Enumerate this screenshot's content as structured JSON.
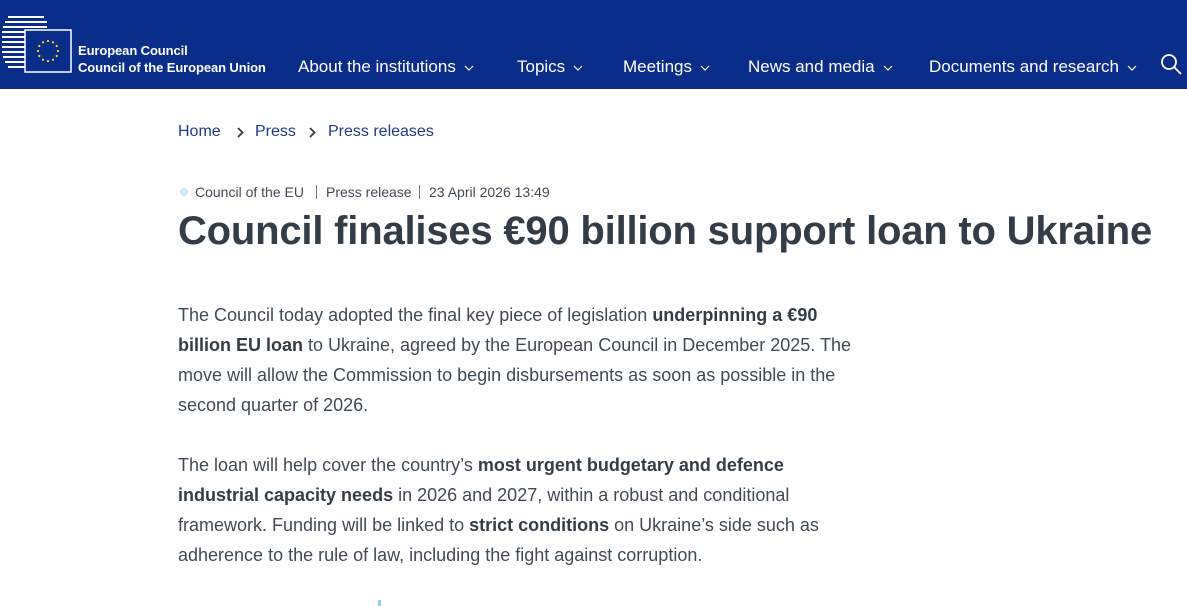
{
  "header": {
    "brand_line1": "European Council",
    "brand_line2": "Council of the European Union",
    "nav": [
      {
        "label": "About the institutions"
      },
      {
        "label": "Topics"
      },
      {
        "label": "Meetings"
      },
      {
        "label": "News and media"
      },
      {
        "label": "Documents and research"
      }
    ],
    "icons": {
      "search": "search-icon",
      "chevron": "chevron-down-icon"
    },
    "colors": {
      "background": "#0a2d8a",
      "text": "#ffffff"
    }
  },
  "breadcrumb": [
    "Home",
    "Press",
    "Press releases"
  ],
  "meta": {
    "source": "Council of the EU",
    "type": "Press release",
    "date": "23 April 2026 13:49"
  },
  "article": {
    "title": "Council finalises €90 billion support loan to Ukraine",
    "p1": {
      "t1": "The Council today adopted the final key piece of legislation ",
      "b1": "underpinning a €90 billion EU loan",
      "t2": " to Ukraine, agreed by the European Council in December 2025. The move will allow the Commission to begin disbursements as soon as possible in the second quarter of 2026."
    },
    "p2": {
      "t1": "The loan will help cover the country’s ",
      "b1": "most urgent budgetary and defence industrial capacity needs",
      "t2": " in 2026 and 2027, within a robust and conditional framework. Funding will be linked to ",
      "b2": "strict conditions",
      "t3": " on Ukraine’s side such as adherence to the rule of law, including the fight against corruption."
    }
  }
}
